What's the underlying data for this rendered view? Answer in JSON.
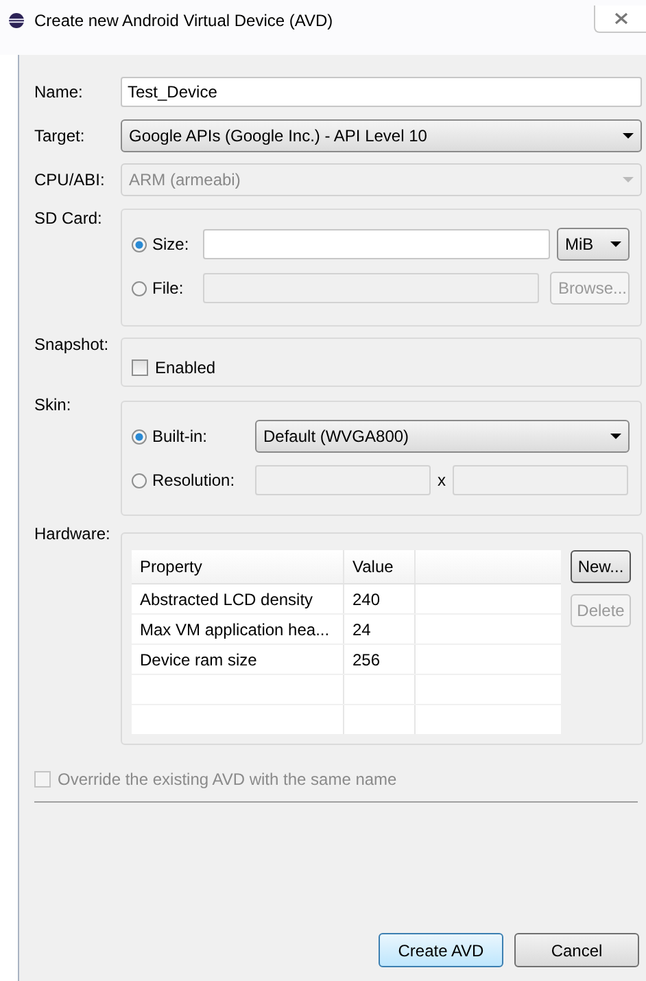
{
  "window": {
    "title": "Create new Android Virtual Device (AVD)"
  },
  "name": {
    "label": "Name:",
    "value": "Test_Device"
  },
  "target": {
    "label": "Target:",
    "value": "Google APIs (Google Inc.) - API Level 10",
    "disabled": false
  },
  "cpu_abi": {
    "label": "CPU/ABI:",
    "value": "ARM (armeabi)",
    "disabled": true
  },
  "sd_card": {
    "label": "SD Card:",
    "options": [
      {
        "label": "Size:",
        "selected": true
      },
      {
        "label": "File:",
        "selected": false
      }
    ],
    "unit": "MiB",
    "browse": {
      "label": "Browse...",
      "disabled": true
    }
  },
  "snapshot": {
    "label": "Snapshot:",
    "option": {
      "label": "Enabled",
      "checked": false
    }
  },
  "skin": {
    "label": "Skin:",
    "options": [
      {
        "label": "Built-in:",
        "selected": true
      },
      {
        "label": "Resolution:",
        "selected": false
      }
    ],
    "builtin_value": "Default (WVGA800)",
    "separator": "x"
  },
  "hardware": {
    "label": "Hardware:",
    "columns": [
      "Property",
      "Value"
    ],
    "rows": [
      {
        "property": "Abstracted LCD density",
        "value": "240"
      },
      {
        "property": "Max VM application hea...",
        "value": "24"
      },
      {
        "property": "Device ram size",
        "value": "256"
      }
    ],
    "buttons": [
      {
        "label": "New...",
        "disabled": false
      },
      {
        "label": "Delete",
        "disabled": true
      }
    ]
  },
  "override": {
    "label": "Override the existing AVD with the same name",
    "checked": false,
    "disabled": true
  },
  "buttons": [
    {
      "label": "Create AVD",
      "default": true
    },
    {
      "label": "Cancel",
      "default": false
    }
  ]
}
